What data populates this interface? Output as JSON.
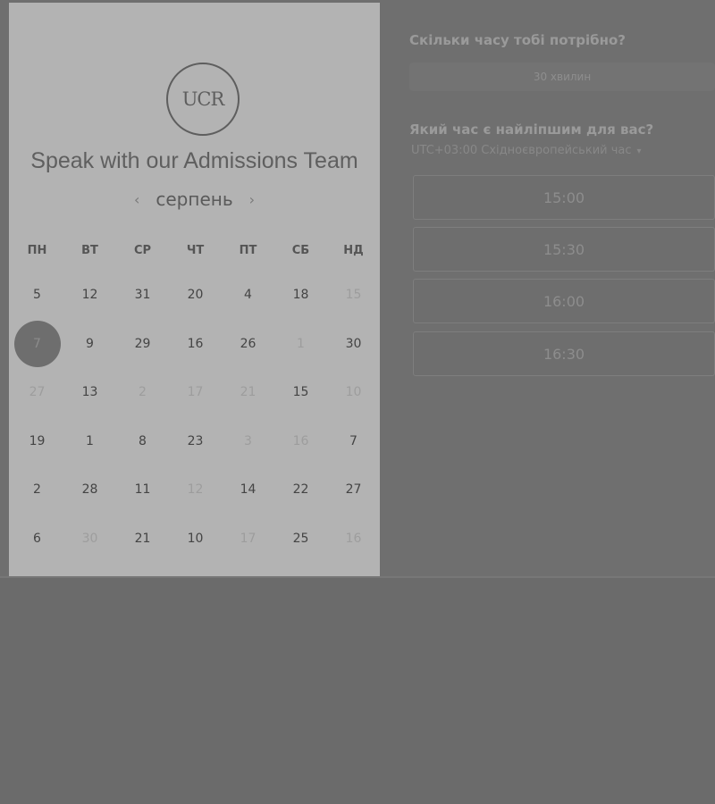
{
  "left": {
    "logo_text": "UCR",
    "title": "Speak with our Admissions Team",
    "month": "серпень",
    "prev_icon": "chevron-left-icon",
    "next_icon": "chevron-right-icon",
    "weekdays": [
      "ПН",
      "ВТ",
      "СР",
      "ЧТ",
      "ПТ",
      "СБ",
      "НД"
    ],
    "weeks": [
      [
        {
          "t": "5"
        },
        {
          "t": "12"
        },
        {
          "t": "31"
        },
        {
          "t": "20"
        },
        {
          "t": "4"
        },
        {
          "t": "18"
        },
        {
          "t": "15",
          "faded": true
        }
      ],
      [
        {
          "t": "7",
          "selected": true
        },
        {
          "t": "9"
        },
        {
          "t": "29"
        },
        {
          "t": "16"
        },
        {
          "t": "26"
        },
        {
          "t": "1",
          "faded": true
        },
        {
          "t": "30"
        }
      ],
      [
        {
          "t": "27",
          "faded": true
        },
        {
          "t": "13"
        },
        {
          "t": "2",
          "faded": true
        },
        {
          "t": "17",
          "faded": true
        },
        {
          "t": "21",
          "faded": true
        },
        {
          "t": "15"
        },
        {
          "t": "10",
          "faded": true
        }
      ],
      [
        {
          "t": "19"
        },
        {
          "t": "1"
        },
        {
          "t": "8"
        },
        {
          "t": "23"
        },
        {
          "t": "3",
          "faded": true
        },
        {
          "t": "16",
          "faded": true
        },
        {
          "t": "7"
        }
      ],
      [
        {
          "t": "2"
        },
        {
          "t": "28"
        },
        {
          "t": "11"
        },
        {
          "t": "12",
          "faded": true
        },
        {
          "t": "14"
        },
        {
          "t": "22"
        },
        {
          "t": "27"
        }
      ],
      [
        {
          "t": "6"
        },
        {
          "t": "30",
          "faded": true
        },
        {
          "t": "21"
        },
        {
          "t": "10"
        },
        {
          "t": "17",
          "faded": true
        },
        {
          "t": "25"
        },
        {
          "t": "16",
          "faded": true
        }
      ]
    ]
  },
  "right": {
    "duration_question": "Скільки часу тобі потрібно?",
    "duration_value": "30 хвилин",
    "time_question": "Який час є найліпшим для вас?",
    "timezone": "UTC+03:00 Східноєвропейський час",
    "timezone_caret": "▾",
    "slots": [
      "15:00",
      "15:30",
      "16:00",
      "16:30"
    ]
  }
}
